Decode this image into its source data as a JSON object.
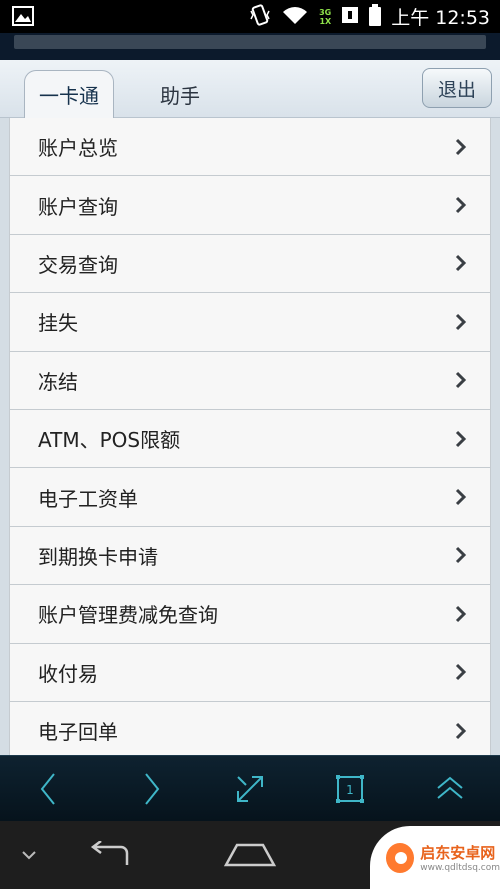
{
  "status": {
    "time": "上午 12:53",
    "network_top": "3G",
    "network_bottom": "1X"
  },
  "tabs": [
    {
      "label": "一卡通"
    },
    {
      "label": "助手"
    }
  ],
  "logout_label": "退出",
  "menu": [
    {
      "label": "账户总览"
    },
    {
      "label": "账户查询"
    },
    {
      "label": "交易查询"
    },
    {
      "label": "挂失"
    },
    {
      "label": "冻结"
    },
    {
      "label": "ATM、POS限额"
    },
    {
      "label": "电子工资单"
    },
    {
      "label": "到期换卡申请"
    },
    {
      "label": "账户管理费减免查询"
    },
    {
      "label": "收付易"
    },
    {
      "label": "电子回单"
    }
  ],
  "toolbar": {
    "tab_count": "1"
  },
  "watermark": {
    "title": "启东安卓网",
    "url": "www.qdltdsq.com"
  }
}
